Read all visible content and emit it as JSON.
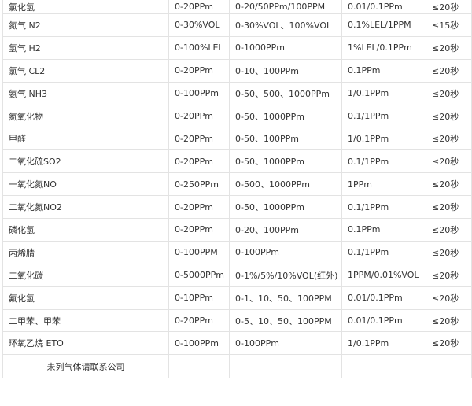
{
  "rows": [
    {
      "gas": "氯化氢",
      "range": "0-20PPm",
      "options": "0-20/50PPm/100PPM",
      "resolution": "0.01/0.1PPm",
      "response": "≤20秒"
    },
    {
      "gas": "氮气 N2",
      "range": "0-30%VOL",
      "options": "0-30%VOL、100%VOL",
      "resolution": "0.1%LEL/1PPM",
      "response": "≤15秒"
    },
    {
      "gas": "氢气 H2",
      "range": "0-100%LEL",
      "options": "0-1000PPm",
      "resolution": "1%LEL/0.1PPm",
      "response": "≤20秒"
    },
    {
      "gas": "氯气 CL2",
      "range": "0-20PPm",
      "options": "0-10、100PPm",
      "resolution": "0.1PPm",
      "response": "≤20秒"
    },
    {
      "gas": "氨气 NH3",
      "range": "0-100PPm",
      "options": "0-50、500、1000PPm",
      "resolution": "1/0.1PPm",
      "response": "≤20秒"
    },
    {
      "gas": "氮氧化物",
      "range": "0-20PPm",
      "options": "0-50、1000PPm",
      "resolution": "0.1/1PPm",
      "response": "≤20秒"
    },
    {
      "gas": "甲醛",
      "range": "0-20PPm",
      "options": "0-50、100PPm",
      "resolution": "1/0.1PPm",
      "response": "≤20秒"
    },
    {
      "gas": "二氧化硫SO2",
      "range": "0-20PPm",
      "options": "0-50、1000PPm",
      "resolution": "0.1/1PPm",
      "response": "≤20秒"
    },
    {
      "gas": "一氧化氮NO",
      "range": "0-250PPm",
      "options": "0-500、1000PPm",
      "resolution": "1PPm",
      "response": "≤20秒"
    },
    {
      "gas": "二氧化氮NO2",
      "range": "0-20PPm",
      "options": "0-50、1000PPm",
      "resolution": "0.1/1PPm",
      "response": "≤20秒"
    },
    {
      "gas": "磷化氢",
      "range": "0-20PPm",
      "options": "0-20、100PPm",
      "resolution": "0.1PPm",
      "response": "≤20秒"
    },
    {
      "gas": "丙烯腈",
      "range": "0-100PPM",
      "options": "0-100PPm",
      "resolution": "0.1/1PPm",
      "response": "≤20秒"
    },
    {
      "gas": "二氧化碳",
      "range": "0-5000PPm",
      "options": "0-1%/5%/10%VOL(红外)",
      "resolution": "1PPM/0.01%VOL",
      "response": "≤20秒"
    },
    {
      "gas": "氟化氢",
      "range": "0-10PPm",
      "options": "0-1、10、50、100PPM",
      "resolution": "0.01/0.1PPm",
      "response": "≤20秒"
    },
    {
      "gas": "二甲苯、甲苯",
      "range": "0-20PPm",
      "options": "0-5、10、50、100PPM",
      "resolution": "0.01/0.1PPm",
      "response": "≤20秒"
    },
    {
      "gas": "环氧乙烷 ETO",
      "range": "0-100PPm",
      "options": "0-100PPm",
      "resolution": "1/0.1PPm",
      "response": "≤20秒"
    }
  ],
  "footer_note": "未列气体请联系公司"
}
